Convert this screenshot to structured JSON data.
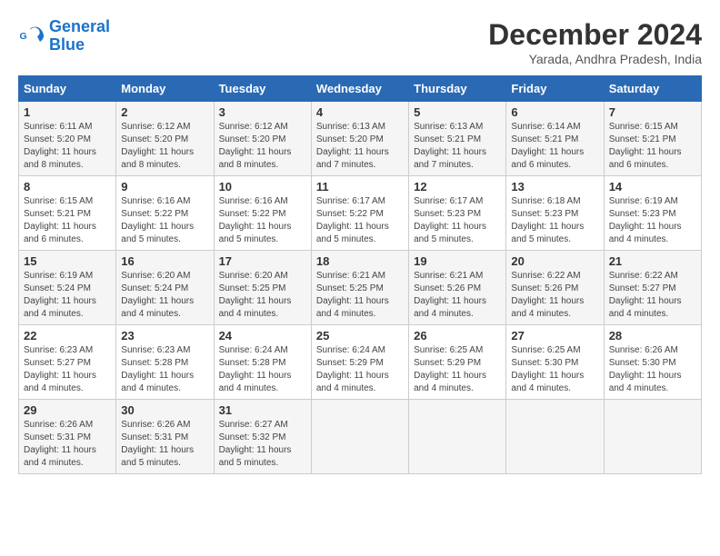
{
  "header": {
    "logo_line1": "General",
    "logo_line2": "Blue",
    "month_title": "December 2024",
    "location": "Yarada, Andhra Pradesh, India"
  },
  "weekdays": [
    "Sunday",
    "Monday",
    "Tuesday",
    "Wednesday",
    "Thursday",
    "Friday",
    "Saturday"
  ],
  "weeks": [
    [
      {
        "day": "1",
        "sunrise": "6:11 AM",
        "sunset": "5:20 PM",
        "daylight": "11 hours and 8 minutes."
      },
      {
        "day": "2",
        "sunrise": "6:12 AM",
        "sunset": "5:20 PM",
        "daylight": "11 hours and 8 minutes."
      },
      {
        "day": "3",
        "sunrise": "6:12 AM",
        "sunset": "5:20 PM",
        "daylight": "11 hours and 8 minutes."
      },
      {
        "day": "4",
        "sunrise": "6:13 AM",
        "sunset": "5:20 PM",
        "daylight": "11 hours and 7 minutes."
      },
      {
        "day": "5",
        "sunrise": "6:13 AM",
        "sunset": "5:21 PM",
        "daylight": "11 hours and 7 minutes."
      },
      {
        "day": "6",
        "sunrise": "6:14 AM",
        "sunset": "5:21 PM",
        "daylight": "11 hours and 6 minutes."
      },
      {
        "day": "7",
        "sunrise": "6:15 AM",
        "sunset": "5:21 PM",
        "daylight": "11 hours and 6 minutes."
      }
    ],
    [
      {
        "day": "8",
        "sunrise": "6:15 AM",
        "sunset": "5:21 PM",
        "daylight": "11 hours and 6 minutes."
      },
      {
        "day": "9",
        "sunrise": "6:16 AM",
        "sunset": "5:22 PM",
        "daylight": "11 hours and 5 minutes."
      },
      {
        "day": "10",
        "sunrise": "6:16 AM",
        "sunset": "5:22 PM",
        "daylight": "11 hours and 5 minutes."
      },
      {
        "day": "11",
        "sunrise": "6:17 AM",
        "sunset": "5:22 PM",
        "daylight": "11 hours and 5 minutes."
      },
      {
        "day": "12",
        "sunrise": "6:17 AM",
        "sunset": "5:23 PM",
        "daylight": "11 hours and 5 minutes."
      },
      {
        "day": "13",
        "sunrise": "6:18 AM",
        "sunset": "5:23 PM",
        "daylight": "11 hours and 5 minutes."
      },
      {
        "day": "14",
        "sunrise": "6:19 AM",
        "sunset": "5:23 PM",
        "daylight": "11 hours and 4 minutes."
      }
    ],
    [
      {
        "day": "15",
        "sunrise": "6:19 AM",
        "sunset": "5:24 PM",
        "daylight": "11 hours and 4 minutes."
      },
      {
        "day": "16",
        "sunrise": "6:20 AM",
        "sunset": "5:24 PM",
        "daylight": "11 hours and 4 minutes."
      },
      {
        "day": "17",
        "sunrise": "6:20 AM",
        "sunset": "5:25 PM",
        "daylight": "11 hours and 4 minutes."
      },
      {
        "day": "18",
        "sunrise": "6:21 AM",
        "sunset": "5:25 PM",
        "daylight": "11 hours and 4 minutes."
      },
      {
        "day": "19",
        "sunrise": "6:21 AM",
        "sunset": "5:26 PM",
        "daylight": "11 hours and 4 minutes."
      },
      {
        "day": "20",
        "sunrise": "6:22 AM",
        "sunset": "5:26 PM",
        "daylight": "11 hours and 4 minutes."
      },
      {
        "day": "21",
        "sunrise": "6:22 AM",
        "sunset": "5:27 PM",
        "daylight": "11 hours and 4 minutes."
      }
    ],
    [
      {
        "day": "22",
        "sunrise": "6:23 AM",
        "sunset": "5:27 PM",
        "daylight": "11 hours and 4 minutes."
      },
      {
        "day": "23",
        "sunrise": "6:23 AM",
        "sunset": "5:28 PM",
        "daylight": "11 hours and 4 minutes."
      },
      {
        "day": "24",
        "sunrise": "6:24 AM",
        "sunset": "5:28 PM",
        "daylight": "11 hours and 4 minutes."
      },
      {
        "day": "25",
        "sunrise": "6:24 AM",
        "sunset": "5:29 PM",
        "daylight": "11 hours and 4 minutes."
      },
      {
        "day": "26",
        "sunrise": "6:25 AM",
        "sunset": "5:29 PM",
        "daylight": "11 hours and 4 minutes."
      },
      {
        "day": "27",
        "sunrise": "6:25 AM",
        "sunset": "5:30 PM",
        "daylight": "11 hours and 4 minutes."
      },
      {
        "day": "28",
        "sunrise": "6:26 AM",
        "sunset": "5:30 PM",
        "daylight": "11 hours and 4 minutes."
      }
    ],
    [
      {
        "day": "29",
        "sunrise": "6:26 AM",
        "sunset": "5:31 PM",
        "daylight": "11 hours and 4 minutes."
      },
      {
        "day": "30",
        "sunrise": "6:26 AM",
        "sunset": "5:31 PM",
        "daylight": "11 hours and 5 minutes."
      },
      {
        "day": "31",
        "sunrise": "6:27 AM",
        "sunset": "5:32 PM",
        "daylight": "11 hours and 5 minutes."
      },
      null,
      null,
      null,
      null
    ]
  ]
}
